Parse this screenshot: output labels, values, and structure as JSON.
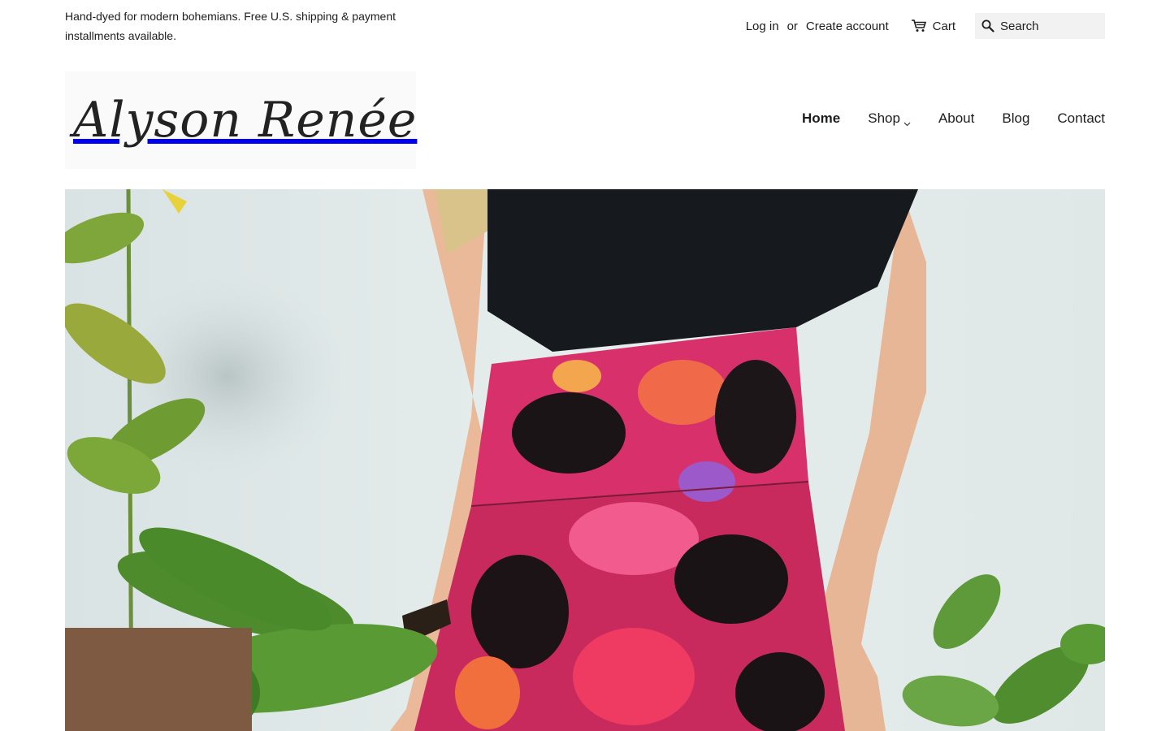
{
  "announcement": "Hand-dyed for modern bohemians. Free U.S. shipping & payment installments available.",
  "account": {
    "login_label": "Log in",
    "or_label": "or",
    "create_label": "Create account",
    "cart_label": "Cart",
    "cart_icon": "cart-icon"
  },
  "search": {
    "placeholder": "Search",
    "icon": "search-icon"
  },
  "logo": {
    "text": "Alyson Renée"
  },
  "nav": {
    "items": [
      {
        "label": "Home",
        "active": true
      },
      {
        "label": "Shop",
        "dropdown": true
      },
      {
        "label": "About"
      },
      {
        "label": "Blog"
      },
      {
        "label": "Contact"
      }
    ]
  },
  "hero": {
    "description": "hero-banner-image",
    "colors": {
      "wall": "#e3ebeb",
      "top": "#16191d",
      "leggings_pink": "#e8336e",
      "plant_green": "#4d8a2e"
    }
  }
}
